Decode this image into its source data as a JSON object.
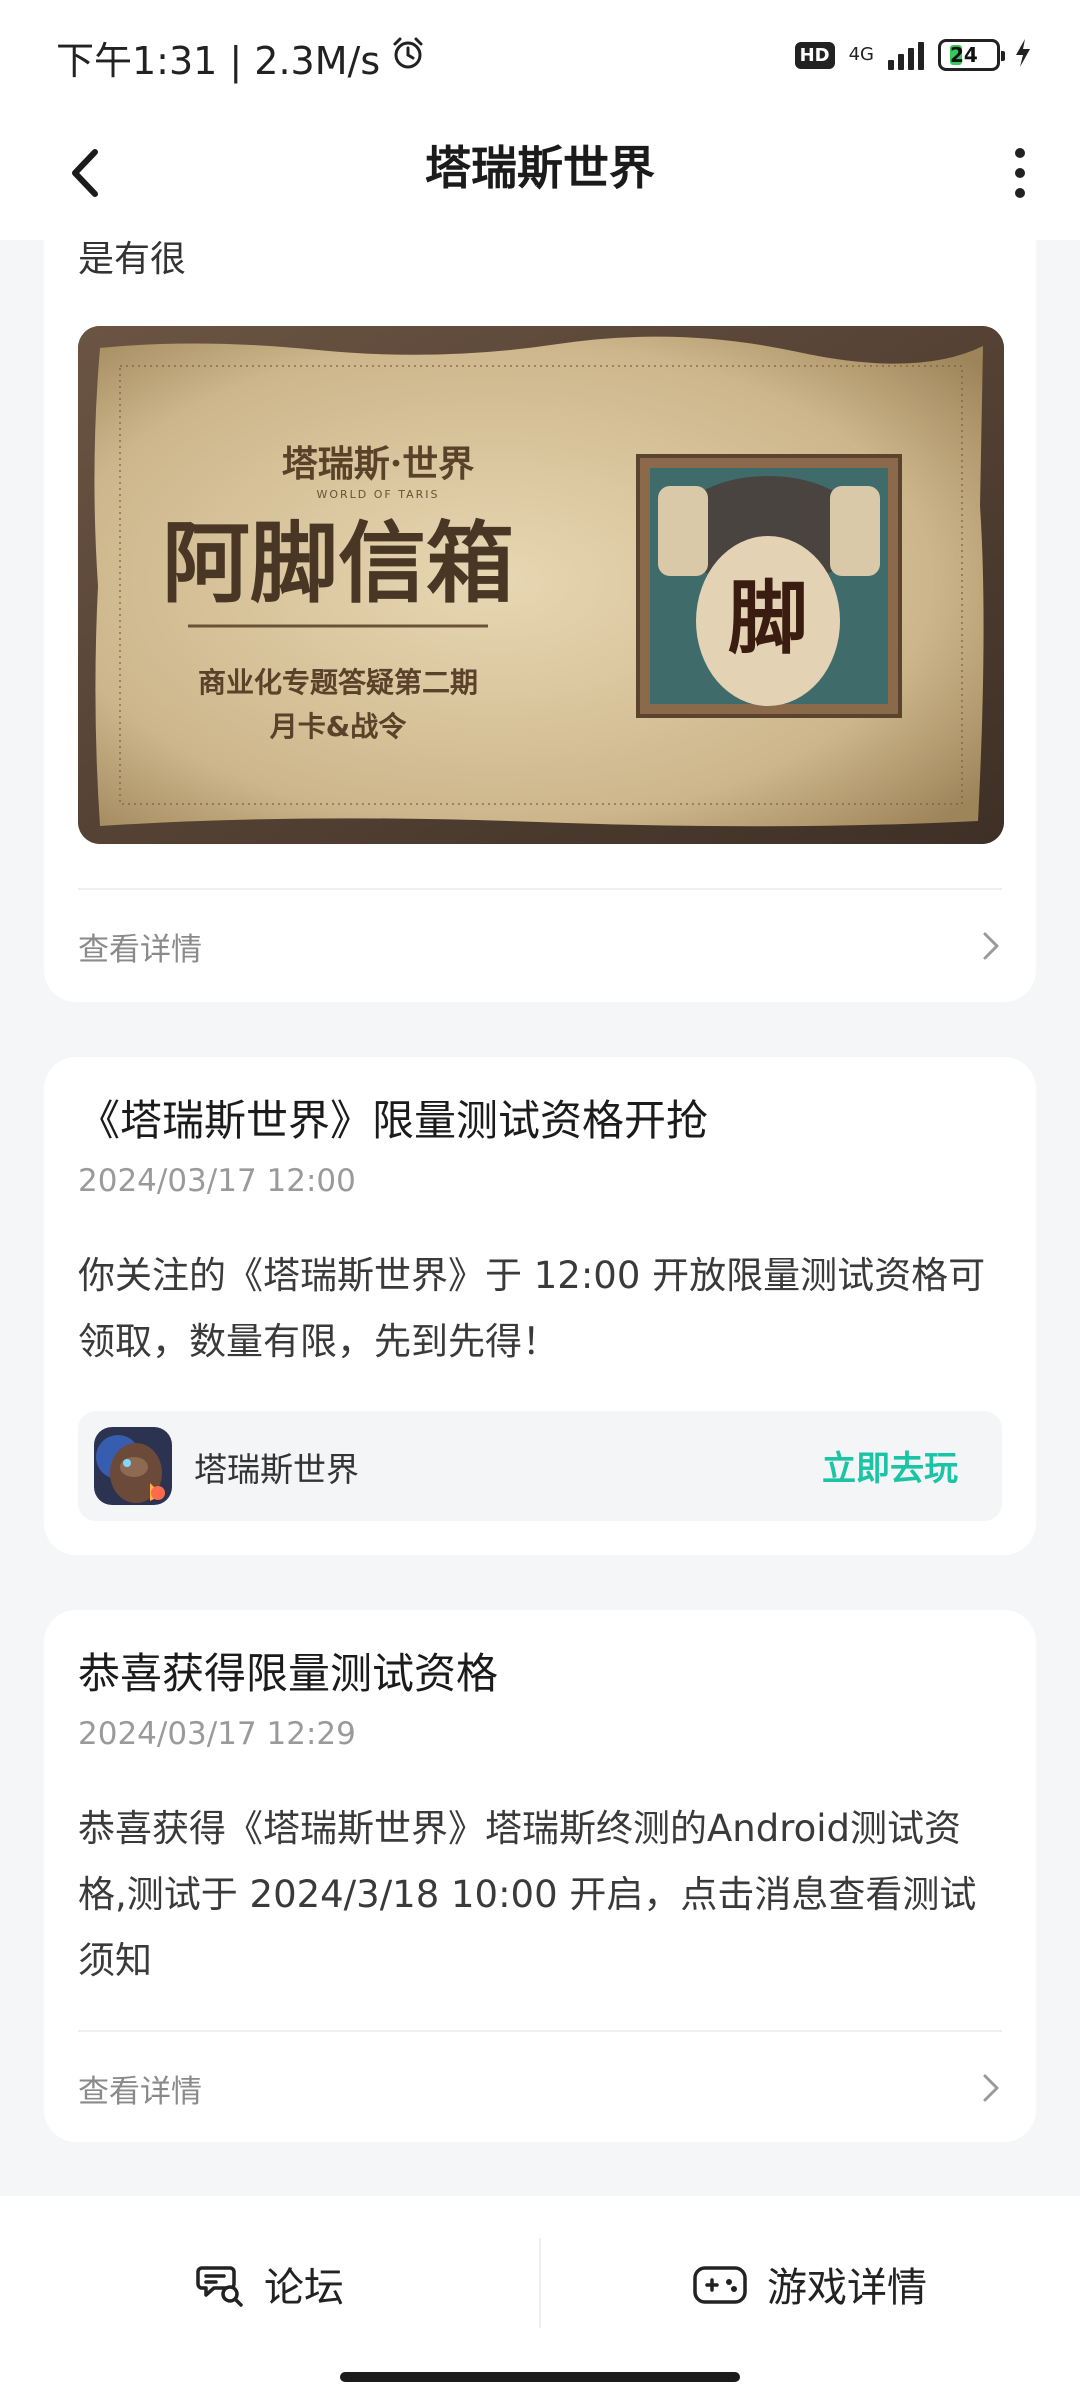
{
  "status_bar": {
    "time_speed": "下午1:31 | 2.3M/s",
    "hd_badge": "HD",
    "network": "4G",
    "battery": "24",
    "battery_level": 0.24
  },
  "header": {
    "title": "塔瑞斯世界"
  },
  "card1": {
    "truncated_text": "是有很",
    "banner": {
      "logo_text": "塔瑞斯·世界",
      "logo_sub": "WORLD OF TARIS",
      "headline": "阿脚信箱",
      "subline1": "商业化专题答疑第二期",
      "subline2": "月卡&战令",
      "portrait_glyph": "脚"
    },
    "detail_label": "查看详情"
  },
  "card2": {
    "title": "《塔瑞斯世界》限量测试资格开抢",
    "date": "2024/03/17 12:00",
    "body": "你关注的《塔瑞斯世界》于 12:00 开放限量测试资格可领取，数量有限，先到先得！",
    "game_name": "塔瑞斯世界",
    "play_label": "立即去玩"
  },
  "card3": {
    "title": "恭喜获得限量测试资格",
    "date": "2024/03/17 12:29",
    "body": "恭喜获得《塔瑞斯世界》塔瑞斯终测的Android测试资格,测试于 2024/3/18 10:00 开启，点击消息查看测试须知",
    "detail_label": "查看详情"
  },
  "bottom_bar": {
    "forum_label": "论坛",
    "game_detail_label": "游戏详情"
  },
  "colors": {
    "accent": "#1bc4a4",
    "background": "#f5f6f8",
    "card": "#ffffff"
  }
}
